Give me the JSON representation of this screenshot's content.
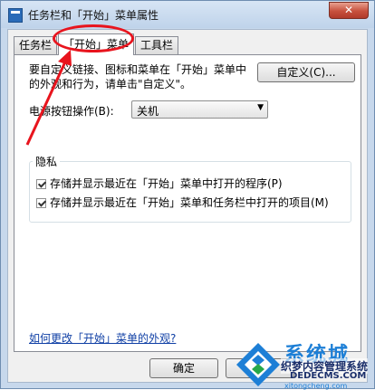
{
  "window": {
    "title": "任务栏和「开始」菜单属性",
    "close_glyph": "✕"
  },
  "tabs": [
    {
      "label": "任务栏",
      "active": false
    },
    {
      "label": "「开始」菜单",
      "active": true
    },
    {
      "label": "工具栏",
      "active": false
    }
  ],
  "panel": {
    "description": "要自定义链接、图标和菜单在「开始」菜单中的外观和行为，请单击\"自定义\"。",
    "customize_button": "自定义(C)...",
    "power_label": "电源按钮操作(B):",
    "power_select": {
      "selected": "关机"
    },
    "privacy_title": "隐私",
    "checkboxes": [
      {
        "label": "存储并显示最近在「开始」菜单中打开的程序(P)",
        "checked": true
      },
      {
        "label": "存储并显示最近在「开始」菜单和任务栏中打开的项目(M)",
        "checked": true
      }
    ],
    "help_link": "如何更改「开始」菜单的外观?"
  },
  "footer": {
    "ok_button": "确定",
    "cancel_button": "取消"
  },
  "watermark": {
    "brand": "系统城",
    "line1": "织梦内容管理系统",
    "url": "DEDECMS.COM",
    "sub": "xitongcheng.com"
  },
  "colors": {
    "annotation": "#e8141d",
    "link": "#0f3fa5",
    "watermark": "#1d7fd6"
  }
}
